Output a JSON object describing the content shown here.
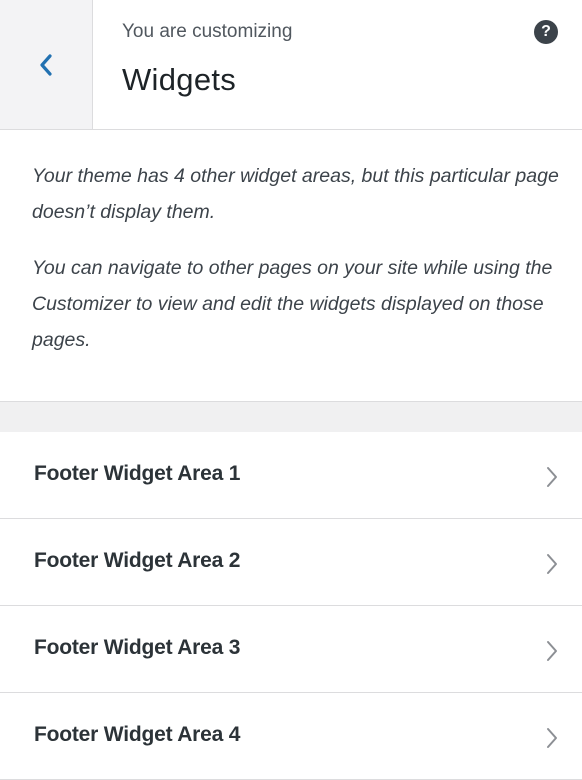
{
  "header": {
    "back_label": "Back",
    "subtitle": "You are customizing",
    "title": "Widgets",
    "help_glyph": "?"
  },
  "description": {
    "paragraphs": [
      "Your theme has 4 other widget areas, but this particular page doesn’t display them.",
      "You can navigate to other pages on your site while using the Customizer to view and edit the widgets displayed on those pages."
    ]
  },
  "widget_areas": [
    {
      "label": "Footer Widget Area 1"
    },
    {
      "label": "Footer Widget Area 2"
    },
    {
      "label": "Footer Widget Area 3"
    },
    {
      "label": "Footer Widget Area 4"
    }
  ],
  "icons": {
    "back": "chevron-left-icon",
    "help": "help-icon",
    "item": "chevron-right-icon"
  },
  "colors": {
    "accent": "#2271b1",
    "text": "#3c434a",
    "heading": "#1d2327",
    "border": "#dcdcde",
    "background": "#f0f0f1"
  }
}
